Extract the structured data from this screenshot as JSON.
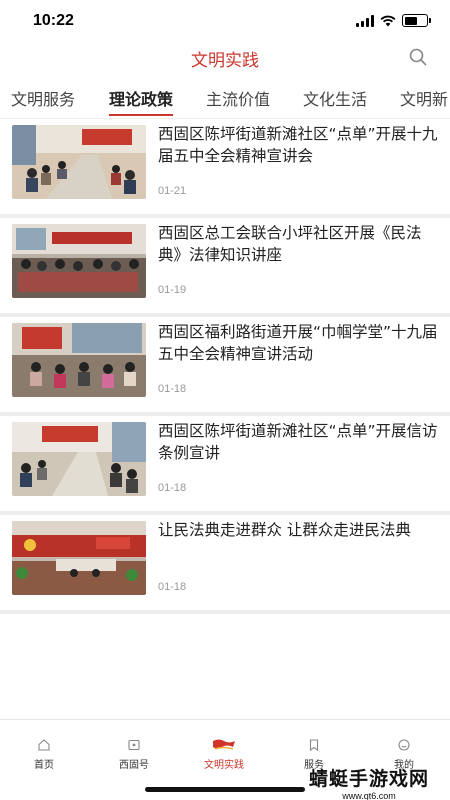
{
  "status_bar": {
    "time": "10:22",
    "battery_level": 0.6
  },
  "header": {
    "title": "文明实践",
    "search_icon": "search-icon"
  },
  "tabs": [
    {
      "label": "文明服务",
      "active": false
    },
    {
      "label": "理论政策",
      "active": true
    },
    {
      "label": "主流价值",
      "active": false
    },
    {
      "label": "文化生活",
      "active": false
    },
    {
      "label": "文明新",
      "active": false
    }
  ],
  "news": [
    {
      "title": "西固区陈坪街道新滩社区“点单”开展十九届五中全会精神宣讲会",
      "date": "01-21"
    },
    {
      "title": "西固区总工会联合小坪社区开展《民法典》法律知识讲座",
      "date": "01-19"
    },
    {
      "title": "西固区福利路街道开展“巾帼学堂”十九届五中全会精神宣讲活动",
      "date": "01-18"
    },
    {
      "title": "西固区陈坪街道新滩社区“点单”开展信访条例宣讲",
      "date": "01-18"
    },
    {
      "title": "让民法典走进群众 让群众走进民法典",
      "date": "01-18"
    }
  ],
  "tabbar": [
    {
      "label": "首页",
      "icon": "home-icon",
      "active": false
    },
    {
      "label": "西固号",
      "icon": "channel-icon",
      "active": false
    },
    {
      "label": "文明实践",
      "icon": "flag-logo-icon",
      "active": true
    },
    {
      "label": "服务",
      "icon": "bookmark-icon",
      "active": false
    },
    {
      "label": "我的",
      "icon": "profile-icon",
      "active": false
    }
  ],
  "watermark": {
    "title": "蜻蜓手游戏网",
    "url": "www.qt6.com"
  },
  "colors": {
    "accent": "#c8372d",
    "separator": "#eeeeee",
    "date": "#999999"
  }
}
